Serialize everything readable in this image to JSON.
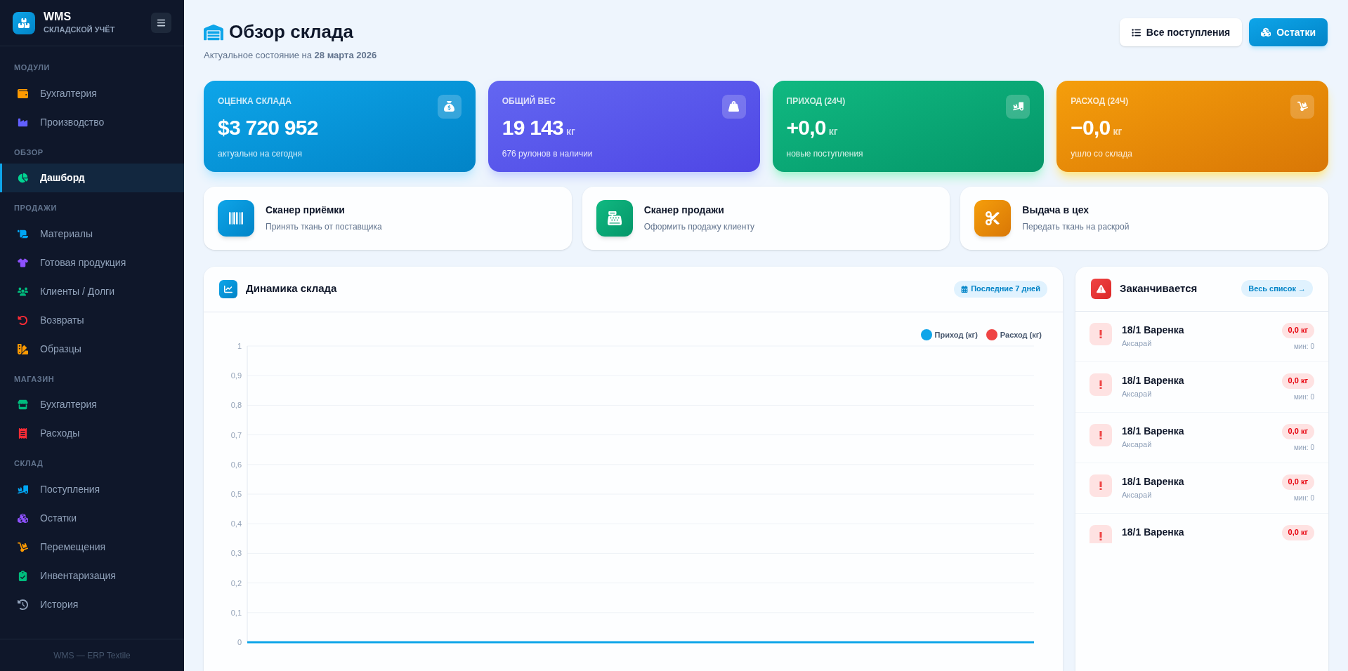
{
  "brand": {
    "title": "WMS",
    "subtitle": "СКЛАДСКОЙ УЧЁТ"
  },
  "sidebar": {
    "sections": [
      {
        "title": "МОДУЛИ",
        "items": [
          {
            "label": "Бухгалтерия",
            "selected": false
          },
          {
            "label": "Производство",
            "selected": false
          }
        ]
      },
      {
        "title": "ОБЗОР",
        "items": [
          {
            "label": "Дашборд",
            "selected": true
          }
        ]
      },
      {
        "title": "ПРОДАЖИ",
        "items": [
          {
            "label": "Материалы",
            "selected": false
          },
          {
            "label": "Готовая продукция",
            "selected": false
          },
          {
            "label": "Клиенты / Долги",
            "selected": false
          },
          {
            "label": "Возвраты",
            "selected": false
          },
          {
            "label": "Образцы",
            "selected": false
          }
        ]
      },
      {
        "title": "МАГАЗИН",
        "items": [
          {
            "label": "Бухгалтерия",
            "selected": false
          },
          {
            "label": "Расходы",
            "selected": false
          }
        ]
      },
      {
        "title": "СКЛАД",
        "items": [
          {
            "label": "Поступления",
            "selected": false
          },
          {
            "label": "Остатки",
            "selected": false
          },
          {
            "label": "Перемещения",
            "selected": false
          },
          {
            "label": "Инвентаризация",
            "selected": false
          },
          {
            "label": "История",
            "selected": false
          }
        ]
      }
    ],
    "footer": "WMS — ERP Textile"
  },
  "header": {
    "title": "Обзор склада",
    "subtitle": "Актуальное состояние на **28 марта 2026**",
    "buttons": [
      {
        "label": "Все поступления",
        "kind": "secondary"
      },
      {
        "label": "Остатки",
        "kind": "primary"
      }
    ]
  },
  "stats": [
    {
      "label": "ОЦЕНКА СКЛАДА",
      "value": "$3 720 952",
      "note": "актуально на сегодня"
    },
    {
      "label": "ОБЩИЙ ВЕС",
      "value": "19 143",
      "unit": "кг",
      "note": "676 рулонов в наличии"
    },
    {
      "label": "ПРИХОД (24Ч)",
      "value": "+0,0",
      "unit": "кг",
      "note": "новые поступления"
    },
    {
      "label": "РАСХОД (24Ч)",
      "value": "−0,0",
      "unit": "кг",
      "note": "ушло со склада"
    }
  ],
  "actions": [
    {
      "title": "Сканер приёмки",
      "subtitle": "Принять ткань от поставщика"
    },
    {
      "title": "Сканер продажи",
      "subtitle": "Оформить продажу клиенту"
    },
    {
      "title": "Выдача в цех",
      "subtitle": "Передать ткань на раскрой"
    }
  ],
  "chart_panel": {
    "title": "Динамика склада",
    "badge": "Последние 7 дней",
    "chart_data": {
      "type": "line",
      "grid": true,
      "ylim": [
        0,
        1
      ],
      "yticks": [
        {
          "value": 0,
          "label": "0"
        },
        {
          "value": 0.1,
          "label": "0,1"
        },
        {
          "value": 0.2,
          "label": "0,2"
        },
        {
          "value": 0.3,
          "label": "0,3"
        },
        {
          "value": 0.4,
          "label": "0,4"
        },
        {
          "value": 0.5,
          "label": "0,5"
        },
        {
          "value": 0.6,
          "label": "0,6"
        },
        {
          "value": 0.7,
          "label": "0,7"
        },
        {
          "value": 0.8,
          "label": "0,8"
        },
        {
          "value": 0.9,
          "label": "0,9"
        },
        {
          "value": 1,
          "label": "1"
        }
      ],
      "series": [
        {
          "name": "Приход (кг)",
          "color": "#0ea5e9",
          "values": [
            0,
            0,
            0,
            0,
            0,
            0,
            0
          ]
        },
        {
          "name": "Расход (кг)",
          "color": "#ef4444",
          "values": [
            null,
            null,
            null,
            null,
            null,
            null,
            null
          ]
        }
      ]
    }
  },
  "low_stock": {
    "title": "Заканчивается",
    "link": "Весь список →",
    "items": [
      {
        "name": "18/1 Варенка",
        "location": "Аксарай",
        "amount": "0,0 кг",
        "min": "мин: 0"
      },
      {
        "name": "18/1 Варенка",
        "location": "Аксарай",
        "amount": "0,0 кг",
        "min": "мин: 0"
      },
      {
        "name": "18/1 Варенка",
        "location": "Аксарай",
        "amount": "0,0 кг",
        "min": "мин: 0"
      },
      {
        "name": "18/1 Варенка",
        "location": "Аксарай",
        "amount": "0,0 кг",
        "min": "мин: 0"
      },
      {
        "name": "18/1 Варенка",
        "amount": "0,0 кг"
      }
    ]
  }
}
